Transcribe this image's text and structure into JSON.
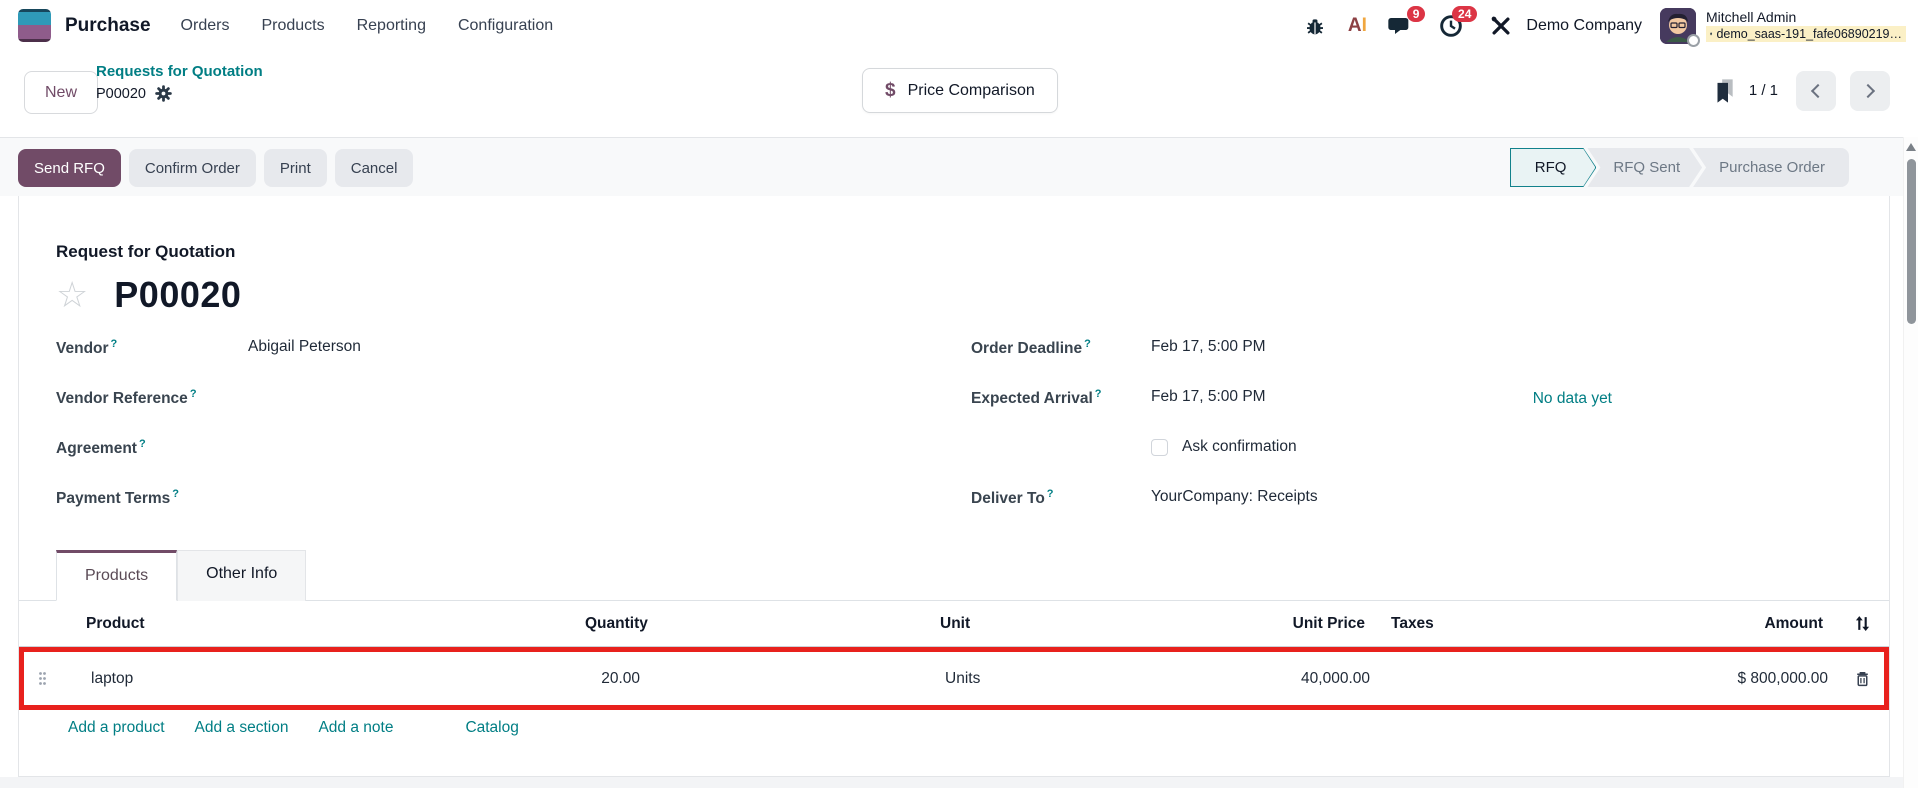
{
  "nav": {
    "app_name": "Purchase",
    "items": [
      {
        "label": "Orders"
      },
      {
        "label": "Products"
      },
      {
        "label": "Reporting"
      },
      {
        "label": "Configuration"
      }
    ]
  },
  "systray": {
    "messages_badge": "9",
    "activities_badge": "24",
    "company": "Demo Company",
    "user_name": "Mitchell Admin",
    "database": "demo_saas-191_fafe06890219…"
  },
  "breadcrumb": {
    "new_button": "New",
    "parent": "Requests for Quotation",
    "current": "P00020"
  },
  "control_panel": {
    "price_comparison": "Price Comparison",
    "pager": "1 / 1"
  },
  "actions": {
    "send_rfq": "Send RFQ",
    "confirm_order": "Confirm Order",
    "print": "Print",
    "cancel": "Cancel"
  },
  "statusbar": {
    "steps": [
      {
        "label": "RFQ"
      },
      {
        "label": "RFQ Sent"
      },
      {
        "label": "Purchase Order"
      }
    ]
  },
  "form": {
    "title_label": "Request for Quotation",
    "reference": "P00020",
    "fields_left": [
      {
        "label": "Vendor",
        "help": "?",
        "value": "Abigail Peterson"
      },
      {
        "label": "Vendor Reference",
        "help": "?",
        "value": ""
      },
      {
        "label": "Agreement",
        "help": "?",
        "value": ""
      },
      {
        "label": "Payment Terms",
        "help": "?",
        "value": ""
      }
    ],
    "fields_right": [
      {
        "label": "Order Deadline",
        "help": "?",
        "value": "Feb 17, 5:00 PM"
      },
      {
        "label": "Expected Arrival",
        "help": "?",
        "value": "Feb 17, 5:00 PM",
        "link": "No data yet"
      },
      {
        "label": "",
        "value": "Ask confirmation"
      },
      {
        "label": "Deliver To",
        "help": "?",
        "value": "YourCompany: Receipts"
      }
    ]
  },
  "tabs": {
    "products": "Products",
    "other_info": "Other Info"
  },
  "table": {
    "headers": {
      "product": "Product",
      "quantity": "Quantity",
      "unit": "Unit",
      "unit_price": "Unit Price",
      "taxes": "Taxes",
      "amount": "Amount"
    },
    "rows": [
      {
        "product": "laptop",
        "quantity": "20.00",
        "unit": "Units",
        "unit_price": "40,000.00",
        "taxes": "",
        "amount": "$ 800,000.00"
      }
    ]
  },
  "footer_links": {
    "add_product": "Add a product",
    "add_section": "Add a section",
    "add_note": "Add a note",
    "catalog": "Catalog"
  },
  "colors": {
    "brand_purple": "#714B67",
    "link_teal": "#017E84",
    "row_highlight_red": "#E8211D",
    "badge_red": "#DC3545",
    "db_highlight_yellow": "#FBF0C6"
  }
}
